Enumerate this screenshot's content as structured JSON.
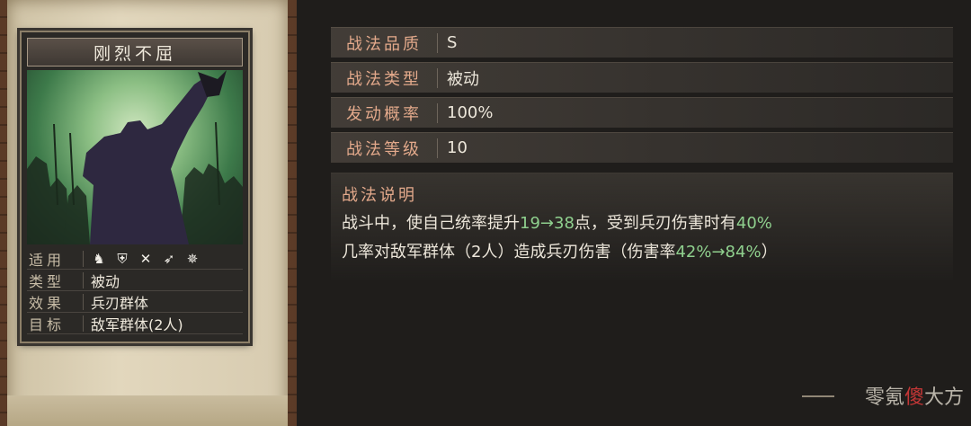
{
  "skill_card": {
    "name": "刚烈不屈",
    "attributes": [
      {
        "key": "适用",
        "value": ""
      },
      {
        "key": "类型",
        "value": "被动"
      },
      {
        "key": "效果",
        "value": "兵刃群体"
      },
      {
        "key": "目标",
        "value": "敌军群体(2人)"
      }
    ],
    "troop_icons": [
      "cavalry-icon",
      "shield-icon",
      "bow-icon",
      "spear-icon",
      "wheel-icon"
    ]
  },
  "details": {
    "rows": [
      {
        "key": "战法品质",
        "value": "S"
      },
      {
        "key": "战法类型",
        "value": "被动"
      },
      {
        "key": "发动概率",
        "value": "100%"
      },
      {
        "key": "战法等级",
        "value": "10"
      }
    ],
    "description_title": "战法说明",
    "description": {
      "p1": "战斗中，使自己统率提升",
      "p1_green": "19→38",
      "p2": "点，受到兵刃伤害时有",
      "p2_green": "40%",
      "p3": "几率对敌军群体（2人）造成兵刃伤害（伤害率",
      "p3_green": "42%→84%",
      "p4": "）"
    }
  },
  "watermark": {
    "text_a": "零氪",
    "text_b": "傻",
    "text_c": "大方"
  }
}
